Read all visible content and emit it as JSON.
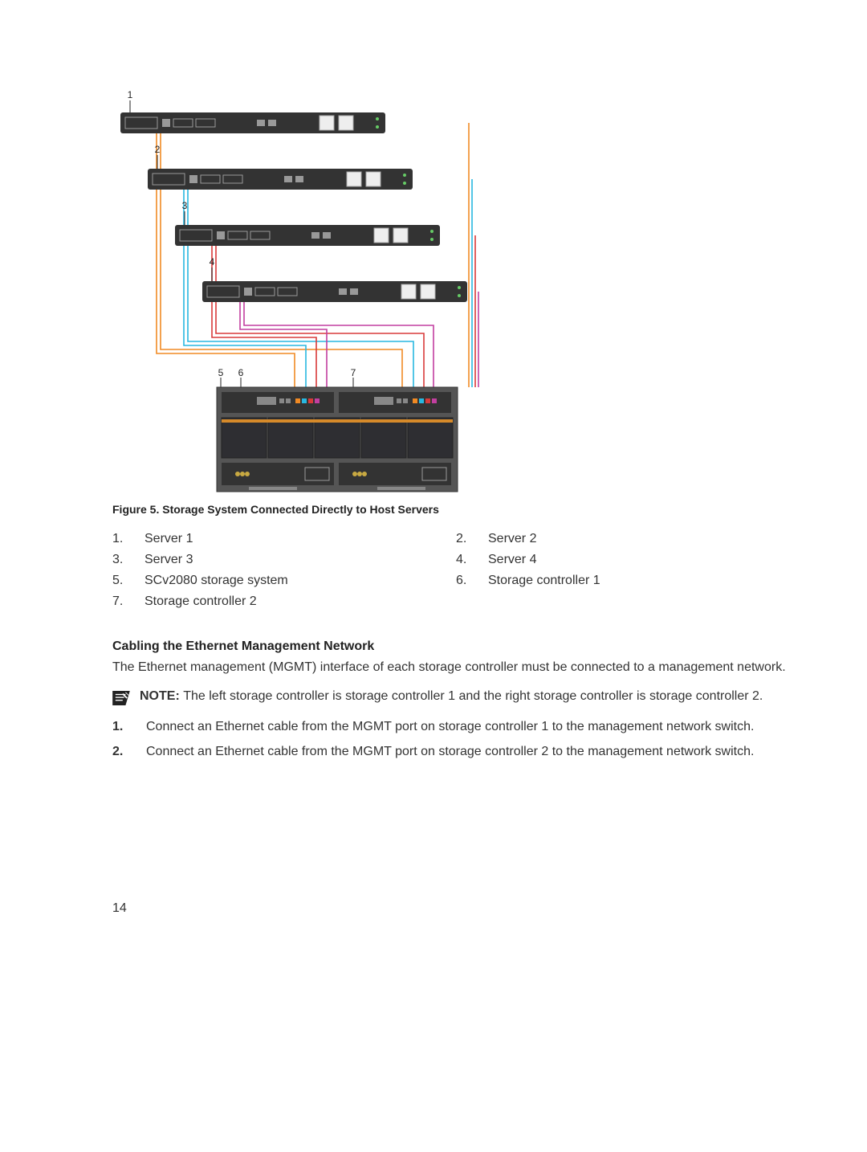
{
  "figure": {
    "caption": "Figure 5. Storage System Connected Directly to Host Servers",
    "callouts": [
      "1",
      "2",
      "3",
      "4",
      "5",
      "6",
      "7"
    ]
  },
  "legend": {
    "items": [
      {
        "n": "1.",
        "t": "Server 1"
      },
      {
        "n": "2.",
        "t": "Server 2"
      },
      {
        "n": "3.",
        "t": "Server 3"
      },
      {
        "n": "4.",
        "t": "Server 4"
      },
      {
        "n": "5.",
        "t": "SCv2080 storage system"
      },
      {
        "n": "6.",
        "t": "Storage controller 1"
      },
      {
        "n": "7.",
        "t": "Storage controller 2"
      }
    ]
  },
  "section": {
    "heading": "Cabling the Ethernet Management Network",
    "intro": "The Ethernet management (MGMT) interface of each storage controller must be connected to a management network.",
    "note_label": "NOTE: ",
    "note_text": "The left storage controller is storage controller 1 and the right storage controller is storage controller 2.",
    "steps": [
      "Connect an Ethernet cable from the MGMT port on storage controller 1 to the management network switch.",
      "Connect an Ethernet cable from the MGMT port on storage controller 2 to the management network switch."
    ]
  },
  "page_number": "14"
}
